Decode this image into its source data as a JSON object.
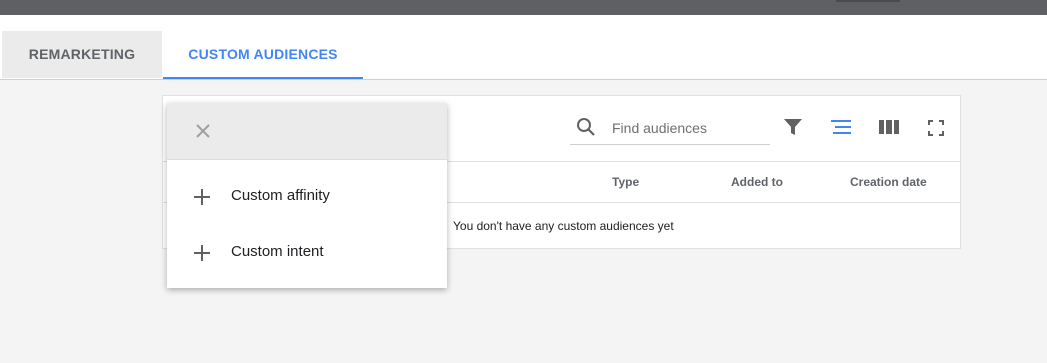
{
  "tabs": [
    {
      "label": "REMARKETING",
      "active": false
    },
    {
      "label": "CUSTOM AUDIENCES",
      "active": true
    }
  ],
  "search": {
    "placeholder": "Find audiences",
    "value": ""
  },
  "toolbar": {
    "icons": [
      "search-icon",
      "filter-icon",
      "segment-icon",
      "columns-icon",
      "fullscreen-icon"
    ]
  },
  "table": {
    "columns": [
      "Type",
      "Added to",
      "Creation date"
    ],
    "empty_message": "You don't have any custom audiences yet"
  },
  "menu": {
    "items": [
      {
        "label": "Custom affinity",
        "icon": "plus-icon"
      },
      {
        "label": "Custom intent",
        "icon": "plus-icon"
      }
    ],
    "close_icon": "close-icon"
  },
  "colors": {
    "accent": "#4285f4",
    "topbar": "#5f6063",
    "background": "#f4f4f4"
  }
}
